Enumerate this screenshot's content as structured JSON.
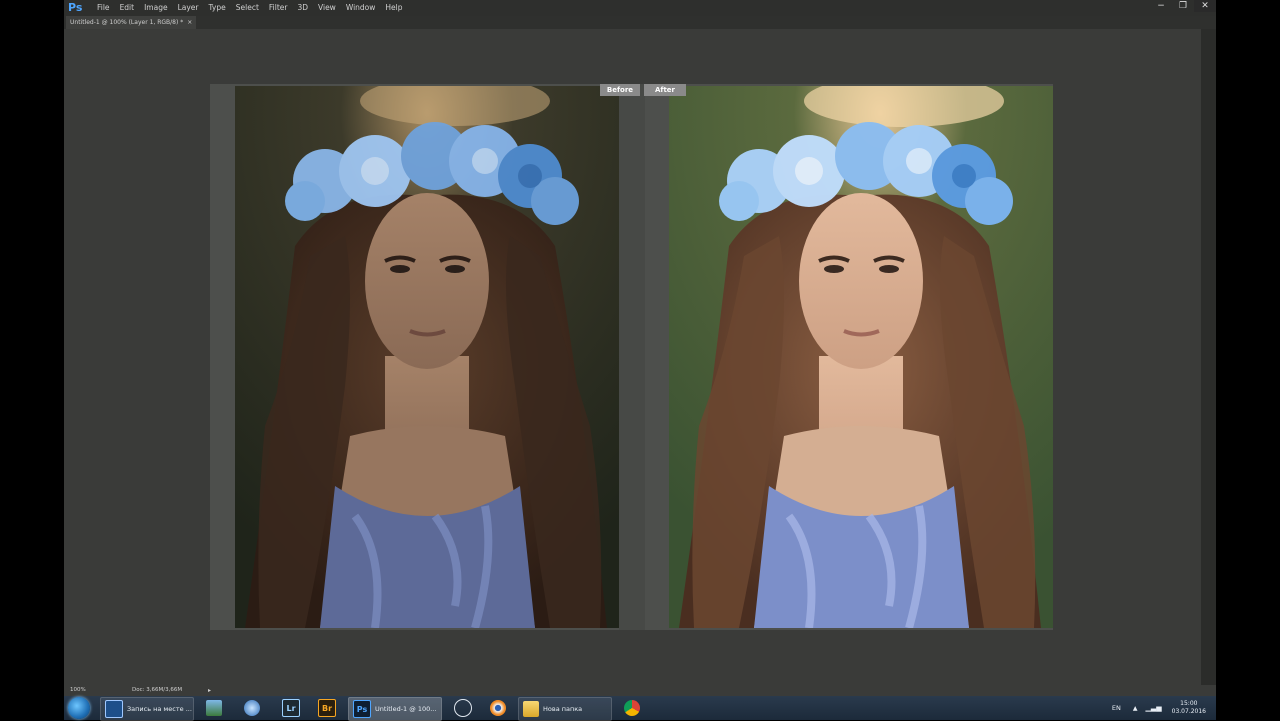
{
  "app": {
    "logo": "Ps"
  },
  "menu": [
    "File",
    "Edit",
    "Image",
    "Layer",
    "Type",
    "Select",
    "Filter",
    "3D",
    "View",
    "Window",
    "Help"
  ],
  "window_controls": {
    "minimize": "−",
    "restore": "❐",
    "close": "✕"
  },
  "document_tab": {
    "title": "Untitled-1 @ 100% (Layer 1, RGB/8) *",
    "close": "×"
  },
  "compare": {
    "before_label": "Before",
    "after_label": "After"
  },
  "status": {
    "zoom": "100%",
    "doc": "Doc: 3,66M/3,66M",
    "arrow": "▸"
  },
  "taskbar": {
    "recording_label": "Запись на месте ...",
    "photoshop_label": "Untitled-1 @ 100...",
    "folder_label": "Нова папка",
    "lightroom_icon": "Lr",
    "bridge_icon": "Br",
    "photoshop_icon": "Ps"
  },
  "tray": {
    "language": "EN",
    "time": "15:00",
    "date": "03.07.2016"
  },
  "colors": {
    "ps_blue": "#4fa6ff",
    "workspace": "#3a3b39",
    "label_bg": "#8a8a8a"
  }
}
